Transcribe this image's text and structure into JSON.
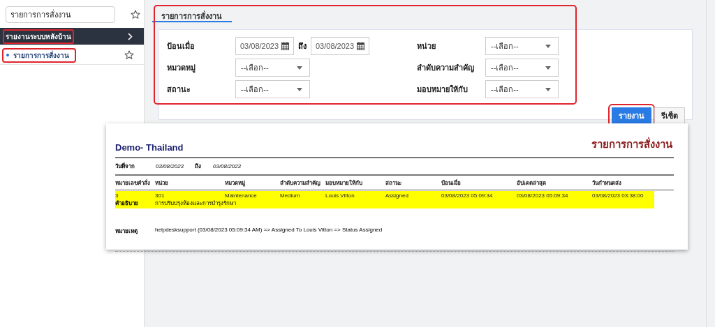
{
  "sidebar": {
    "search": {
      "value": "รายการการสั่งงาน"
    },
    "section": {
      "label": "รายงานระบบหลังบ้าน",
      "highlighted": true
    },
    "items": [
      {
        "label": "รายการการสั่งงาน",
        "selected": true,
        "highlighted": true
      }
    ]
  },
  "tabs": [
    {
      "label": "รายการการสั่งงาน",
      "selected": true
    }
  ],
  "filters": {
    "highlighted": true,
    "fields": [
      {
        "kind": "daterange",
        "label": "ป้อนเมื่อ",
        "from": "03/08/2023",
        "to_label": "ถึง",
        "to": "03/08/2023"
      },
      {
        "kind": "select",
        "label": "หน่วย",
        "value": "--เลือก--"
      },
      {
        "kind": "select",
        "label": "หมวดหมู่",
        "value": "--เลือก--"
      },
      {
        "kind": "select",
        "label": "ลำดับความสำคัญ",
        "value": "--เลือก--"
      },
      {
        "kind": "select",
        "label": "สถานะ",
        "value": "--เลือก--"
      },
      {
        "kind": "select",
        "label": "มอบหมายให้กับ",
        "value": "--เลือก--"
      }
    ]
  },
  "buttons": [
    {
      "label": "รายงาน",
      "kind": "primary",
      "highlighted": true
    },
    {
      "label": "รีเซ็ต",
      "kind": "secondary",
      "highlighted": false
    }
  ],
  "report": {
    "company": "Demo- Thailand",
    "title": "รายการการสั่งงาน",
    "date_from_label": "วันที่จาก",
    "date_from": "03/08/2023",
    "to_label": "ถึง",
    "date_to": "03/08/2023",
    "columns": [
      "หมายเลขคำสั่ง",
      "หน่วย",
      "หมวดหมู่",
      "ลำดับความสำคัญ",
      "มอบหมายให้กับ",
      "สถานะ",
      "ป้อนเมื่อ",
      "อัปเดตล่าสุด",
      "วันกำหนดส่ง"
    ],
    "rows": [
      {
        "highlighted": true,
        "cells": [
          "3",
          "301",
          "Maintenance",
          "Medium",
          "Louis Vitton",
          "Assigned",
          "03/08/2023 05:09:34",
          "03/08/2023 05:09:34",
          "03/08/2023 03:38:00"
        ],
        "description_label": "คำอธิบาย",
        "description": "การปรับปรุงห้องและการบำรุงรักษา"
      }
    ],
    "note_label": "หมายเหตุ",
    "note": "helpdesksupport (03/08/2023 05:09:34 AM) => Assigned To Louis Vitton => Status Assigned"
  }
}
